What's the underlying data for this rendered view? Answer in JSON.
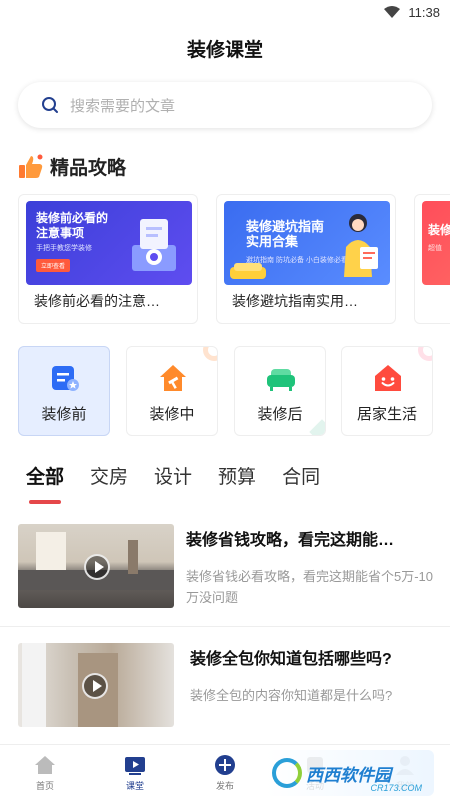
{
  "status_bar": {
    "time": "11:38"
  },
  "header": {
    "title": "装修课堂"
  },
  "search": {
    "placeholder": "搜索需要的文章"
  },
  "featured": {
    "heading": "精品攻略",
    "cards": [
      {
        "title": "装修前必看的注意…",
        "banner_title": "装修前必看的\n注意事项",
        "banner_sub": "手把手教您学装修",
        "banner_btn": "立即查看",
        "banner_color": "#3b3fd8"
      },
      {
        "title": "装修避坑指南实用…",
        "banner_title": "装修避坑指南\n实用合集",
        "banner_sub": "避坑指南 防坑必备 小白装修必看",
        "banner_btn": "",
        "banner_color": "#3a6cf0"
      },
      {
        "title": "",
        "banner_title": "装修",
        "banner_sub": "超值",
        "banner_btn": "",
        "banner_color": "#ff4d5a"
      }
    ]
  },
  "categories": [
    {
      "label": "装修前",
      "icon": "document-star-icon",
      "color": "#2d6cf5",
      "active": true
    },
    {
      "label": "装修中",
      "icon": "house-hammer-icon",
      "color": "#ff8a2b",
      "active": false
    },
    {
      "label": "装修后",
      "icon": "sofa-icon",
      "color": "#1fc37a",
      "active": false
    },
    {
      "label": "居家生活",
      "icon": "smile-house-icon",
      "color": "#ff4b3e",
      "active": false
    }
  ],
  "tabs": [
    "全部",
    "交房",
    "设计",
    "预算",
    "合同"
  ],
  "articles": [
    {
      "title": "装修省钱攻略，看完这期能…",
      "desc": "装修省钱必看攻略，看完这期能省个5万-10万没问题"
    },
    {
      "title": "装修全包你知道包括哪些吗?",
      "desc": "装修全包的内容你知道都是什么吗?"
    }
  ],
  "bottom_nav": [
    {
      "label": "首页",
      "icon": "home-icon",
      "active": false
    },
    {
      "label": "课堂",
      "icon": "play-board-icon",
      "active": true
    },
    {
      "label": "发布",
      "icon": "plus-circle-icon",
      "active": false
    },
    {
      "label": "活动",
      "icon": "activity-icon",
      "active": false
    },
    {
      "label": "我的",
      "icon": "profile-icon",
      "active": false
    }
  ],
  "watermark": {
    "text": "西西软件园",
    "sub": "CR173.COM"
  },
  "colors": {
    "accent_red": "#e5474a",
    "brand_blue": "#223f8f"
  }
}
